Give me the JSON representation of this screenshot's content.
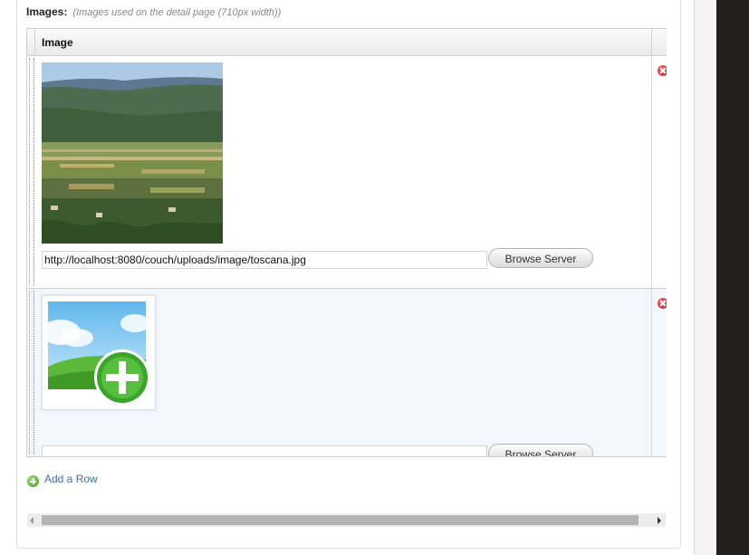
{
  "field": {
    "label": "Images:",
    "hint": "(Images used on the detail page (710px width))"
  },
  "grid": {
    "column_header": "Image",
    "rows": [
      {
        "image_url": "http://localhost:8080/couch/uploads/image/toscana.jpg",
        "browse_label": "Browse Server",
        "thumbnail_icon": "landscape-photo"
      },
      {
        "image_url": "",
        "browse_label": "Browse Server",
        "thumbnail_icon": "add-image-placeholder-icon"
      }
    ]
  },
  "add_row_label": "Add a Row",
  "colors": {
    "link": "#3e6da2",
    "row_highlight": "#f2f7fd",
    "delete_red": "#c62828",
    "add_green": "#4caf32"
  }
}
